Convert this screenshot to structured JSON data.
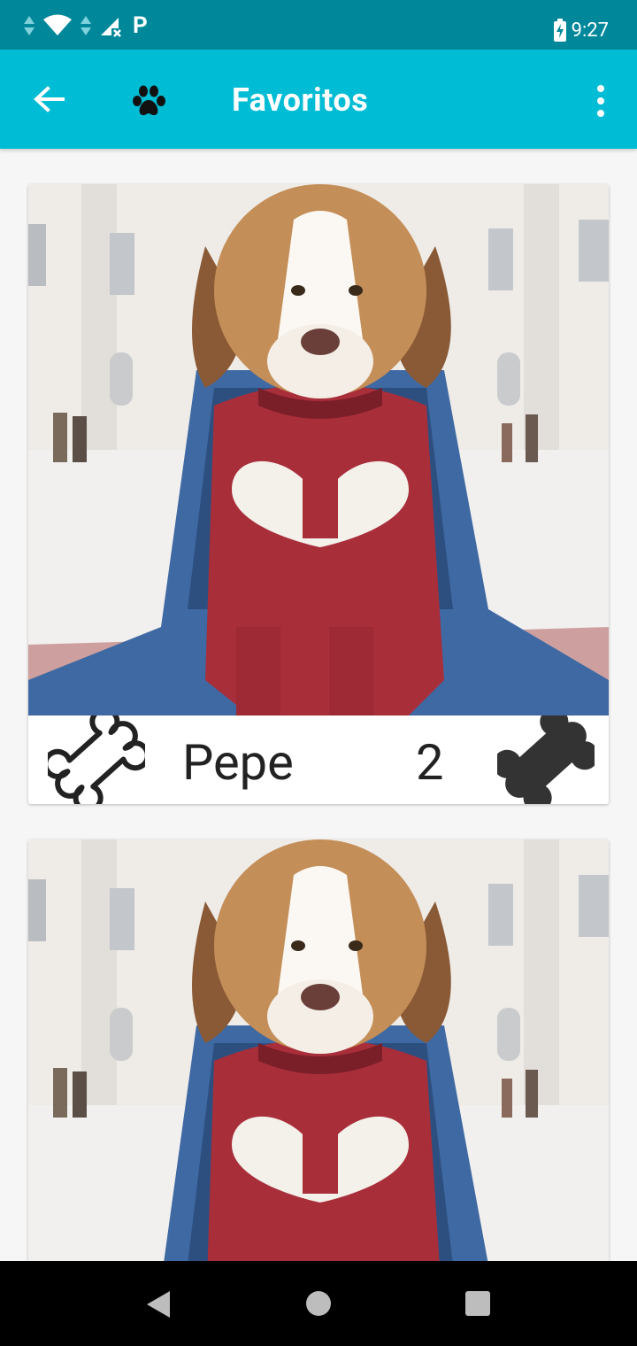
{
  "status_bar": {
    "time": "9:27",
    "icons": [
      "data-arrows-icon",
      "wifi-icon",
      "data-arrows-icon",
      "cell-signal-off-icon",
      "parking-notification-icon",
      "battery-charging-icon"
    ],
    "p_label": "P"
  },
  "app_bar": {
    "title": "Favoritos",
    "back_icon": "arrow-back-icon",
    "logo_icon": "paw-icon",
    "menu_icon": "more-vert-icon",
    "color": "#00bcd4",
    "status_color": "#00889a"
  },
  "favorites": [
    {
      "name": "Pepe",
      "rating": "2"
    },
    {
      "name": "",
      "rating": ""
    }
  ],
  "nav_bar": {
    "icons": [
      "nav-back-icon",
      "nav-home-icon",
      "nav-recents-icon"
    ]
  }
}
